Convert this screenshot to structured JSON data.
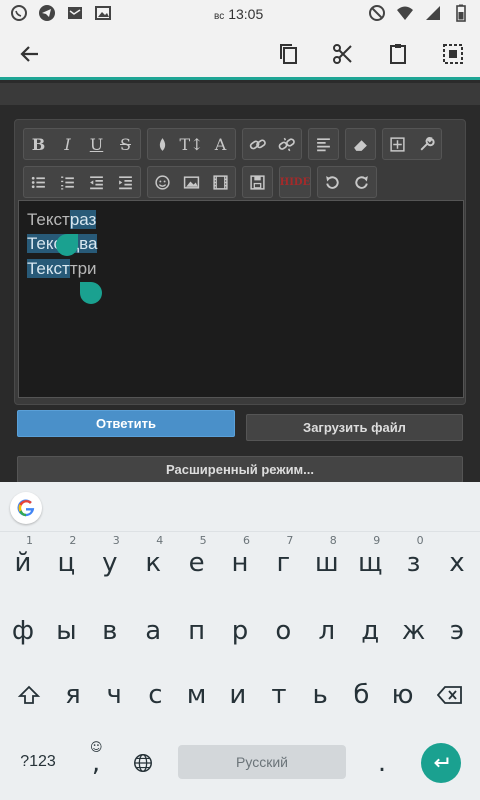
{
  "status_bar": {
    "time_prefix": "вс",
    "time": "13:05"
  },
  "action_bar": {
    "back": "back-arrow-icon",
    "actions": [
      "copy-icon",
      "cut-icon",
      "paste-icon",
      "select-all-icon"
    ]
  },
  "editor": {
    "lines": [
      {
        "plain": "Текст",
        "selected": "раз"
      },
      {
        "selected_prefix": "Текст",
        "selected": "два"
      },
      {
        "selected_prefix": "Текст",
        "plain": "три"
      }
    ],
    "toolbar_text": {
      "bold": "B",
      "italic": "I",
      "underline": "U",
      "strike": "S",
      "size": "T↕",
      "font": "A",
      "hide": "HIDE"
    }
  },
  "buttons": {
    "reply": "Ответить",
    "upload": "Загрузить файл",
    "advanced": "Расширенный режим..."
  },
  "keyboard": {
    "row1": [
      "й",
      "ц",
      "у",
      "к",
      "е",
      "н",
      "г",
      "ш",
      "щ",
      "з",
      "х"
    ],
    "row1_hints": [
      "1",
      "2",
      "3",
      "4",
      "5",
      "6",
      "7",
      "8",
      "9",
      "0"
    ],
    "row2": [
      "ф",
      "ы",
      "в",
      "а",
      "п",
      "р",
      "о",
      "л",
      "д",
      "ж",
      "э"
    ],
    "row3": [
      "я",
      "ч",
      "с",
      "м",
      "и",
      "т",
      "ь",
      "б",
      "ю"
    ],
    "symbols_label": "?123",
    "comma": ",",
    "period": ".",
    "space_label": "Русский"
  },
  "colors": {
    "accent": "#1aa190",
    "selection": "#285a78",
    "reply_button": "#4a90c9"
  }
}
